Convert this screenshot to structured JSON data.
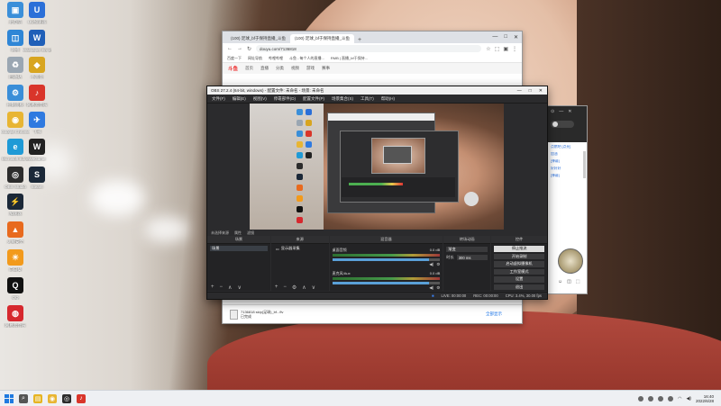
{
  "desktop": {
    "icons": [
      {
        "label": "此电脑",
        "color": "#3b8fd9",
        "glyph": "▣"
      },
      {
        "label": "UU加速器",
        "color": "#2b6fd8",
        "glyph": "U"
      },
      {
        "label": "网络",
        "color": "#2f86d6",
        "glyph": "◫"
      },
      {
        "label": "Wallpaper Engine",
        "color": "#1f5fb8",
        "glyph": "W"
      },
      {
        "label": "回收站",
        "color": "#9aa6b2",
        "glyph": "♻"
      },
      {
        "label": "小黑盒",
        "color": "#d8a520",
        "glyph": "◆"
      },
      {
        "label": "控制面板",
        "color": "#3a8ed8",
        "glyph": "⚙"
      },
      {
        "label": "网易云音乐",
        "color": "#d9352a",
        "glyph": "♪"
      },
      {
        "label": "Google Chrome",
        "color": "#e8b533",
        "glyph": "◉"
      },
      {
        "label": "飞书",
        "color": "#2f7ae0",
        "glyph": "✈"
      },
      {
        "label": "Microsoft Edge",
        "color": "#1f9ad6",
        "glyph": "e"
      },
      {
        "label": "WeGame",
        "color": "#222222",
        "glyph": "W"
      },
      {
        "label": "OBS Studio",
        "color": "#2c2c2c",
        "glyph": "◎"
      },
      {
        "label": "Steam",
        "color": "#1b2838",
        "glyph": "S"
      },
      {
        "label": "加速器",
        "color": "#1b2838",
        "glyph": "⚡"
      },
      {
        "label": "火绒安全",
        "color": "#e86a1e",
        "glyph": "▲"
      },
      {
        "label": "向日葵",
        "color": "#f29a1c",
        "glyph": "☀"
      },
      {
        "label": "QQ",
        "color": "#111111",
        "glyph": "Q"
      },
      {
        "label": "网易云音乐",
        "color": "#d6282e",
        "glyph": "◍"
      }
    ]
  },
  "browser": {
    "tabs": [
      "(100) 足球_bf于保持直播_斗鱼",
      "(100) 足球_bf于保持直播_斗鱼"
    ],
    "tab_new": "+",
    "window_controls": [
      "—",
      "□",
      "✕"
    ],
    "url": "douyu.com/7136818",
    "toolbar_icons": [
      "☆",
      "⬚",
      "▣",
      "⋮"
    ],
    "bookmarks": [
      "百度一下",
      "网址导航",
      "哔哩哔哩",
      "斗鱼 - 每个人的直播...",
      "RMB | 直播_bf于保持..."
    ],
    "site_logo": "斗鱼",
    "site_nav": [
      "首页",
      "直播",
      "分类",
      "视频",
      "游戏",
      "赛事"
    ],
    "download": {
      "file_name": "7136818 skip(足球)_bf...flv",
      "file_status": "已完成",
      "show_all": "全部显示"
    }
  },
  "obs": {
    "title": "OBS 27.2.4 (64-bit, windows) - 配置文件: 未命名 - 场景: 未命名",
    "window_controls": [
      "—",
      "□",
      "✕"
    ],
    "menu": [
      "文件(F)",
      "编辑(E)",
      "视图(V)",
      "停靠部件(D)",
      "配置文件(P)",
      "场景集合(S)",
      "工具(T)",
      "帮助(H)"
    ],
    "source_bar": [
      "未选择来源",
      "属性",
      "滤镜"
    ],
    "docks": {
      "scenes": {
        "title": "场景",
        "items": [
          "场景"
        ],
        "footer": [
          "+",
          "−",
          "∧",
          "∨"
        ]
      },
      "sources": {
        "title": "来源",
        "items": [
          "显示器采集"
        ],
        "footer": [
          "+",
          "−",
          "⚙",
          "∧",
          "∨"
        ]
      },
      "mixer": {
        "title": "混音器",
        "tracks": [
          {
            "name": "桌面音频",
            "db": "0.0 dB",
            "level": 0.9
          },
          {
            "name": "麦克风/Aux",
            "db": "0.0 dB",
            "level": 0.9
          }
        ],
        "icons": [
          "◀)",
          "⚙"
        ]
      },
      "transitions": {
        "title": "转场动画",
        "select": "渐变",
        "duration_label": "时长",
        "duration_value": "300 ms"
      },
      "controls": {
        "title": "控件",
        "buttons": [
          "停止推流",
          "开始录制",
          "启动虚拟摄像机",
          "工作室模式",
          "设置",
          "退出"
        ]
      }
    },
    "status": [
      "LIVE: 00:00:00",
      "REC: 00:00:00",
      "CPU: 3.4%, 30.00 fps"
    ]
  },
  "chat": {
    "lines": [
      "点燃吧 [点亮]",
      "加油",
      "[弹幕]",
      "好好好",
      "[弹幕]"
    ],
    "footer_icons": [
      "☺",
      "◫",
      "⬚"
    ]
  },
  "taskbar": {
    "app_icons": [
      {
        "name": "search",
        "color": "#555555",
        "glyph": "⌕"
      },
      {
        "name": "file-explorer",
        "color": "#e6b422",
        "glyph": "▤"
      },
      {
        "name": "chrome",
        "color": "#e8b533",
        "glyph": "◉"
      },
      {
        "name": "obs",
        "color": "#2c2c2c",
        "glyph": "◎"
      },
      {
        "name": "netease",
        "color": "#d9352a",
        "glyph": "♪"
      }
    ],
    "clock_time": "16:40",
    "clock_date": "2022/6/28"
  }
}
